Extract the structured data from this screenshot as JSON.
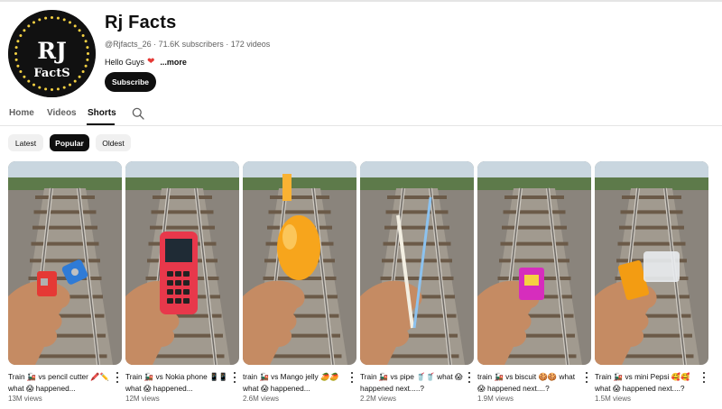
{
  "channel": {
    "name": "Rj Facts",
    "avatar_text_top": "RJ",
    "avatar_text_bottom": "FactS",
    "meta": "@Rjfacts_26 · 71.6K subscribers · 172 videos",
    "description": "Hello Guys",
    "more_label": "...more",
    "subscribe_label": "Subscribe"
  },
  "tabs": [
    {
      "label": "Home",
      "active": false
    },
    {
      "label": "Videos",
      "active": false
    },
    {
      "label": "Shorts",
      "active": true
    }
  ],
  "search_icon": "search-icon",
  "filters": [
    {
      "label": "Latest",
      "selected": false
    },
    {
      "label": "Popular",
      "selected": true
    },
    {
      "label": "Oldest",
      "selected": false
    }
  ],
  "shorts": [
    {
      "title": "Train 🚂 vs pencil cutter 🖍️✏️ what 😱 happened...",
      "views": "13M views",
      "object": "pencil-sharpeners"
    },
    {
      "title": "Train 🚂 vs Nokia phone 📱📱 what 😱 happened...",
      "views": "12M views",
      "object": "nokia-phone"
    },
    {
      "title": "train 🚂 vs Mango jelly 🥭🥭 what 😱 happened...",
      "views": "2.6M views",
      "object": "mango-jelly"
    },
    {
      "title": "Train 🚂 vs pipe 🥤🥤 what 😱 happened next.....?",
      "views": "2.2M views",
      "object": "straw-pipe"
    },
    {
      "title": "train 🚂 vs biscuit 🍪🍪 what 😱 happened next....?",
      "views": "1.9M views",
      "object": "biscuit-pack"
    },
    {
      "title": "Train 🚂 vs mini Pepsi 🥰🥰 what 😱 happened next....?",
      "views": "1.5M views",
      "object": "mini-pepsi"
    }
  ],
  "colors": {
    "accent": "#0f0f0f",
    "secondary_text": "#606060",
    "chip_bg": "#f0f0f0",
    "heart": "#e53935",
    "avatar_ring_dots": "#f5d142"
  }
}
